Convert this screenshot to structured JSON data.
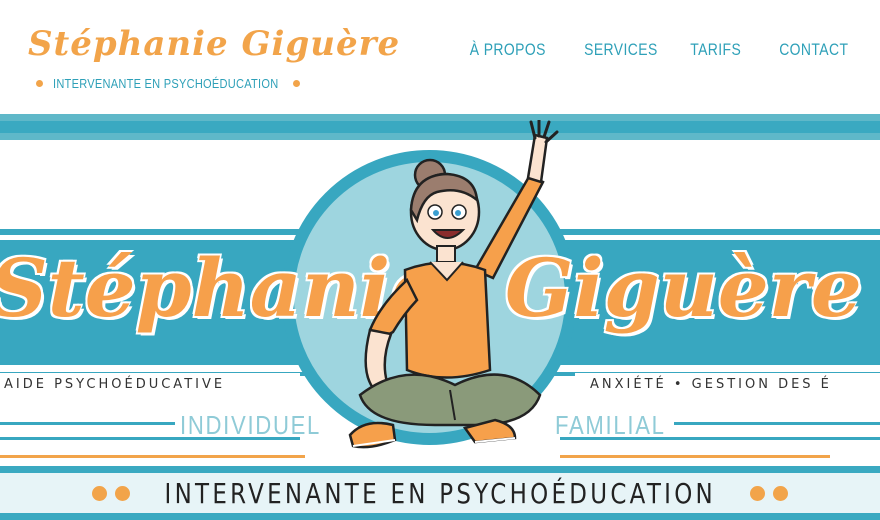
{
  "logo": {
    "name": "Stéphanie Giguère",
    "tagline": "INTERVENANTE EN PSYCHOÉDUCATION"
  },
  "nav": {
    "items": [
      "À PROPOS",
      "SERVICES",
      "TARIFS",
      "CONTACT"
    ]
  },
  "banner": {
    "first_name": "Stéphanie",
    "last_name": "Giguère",
    "strip_left": "AIDE PSYCHOÉDUCATIVE",
    "strip_right": "ANXIÉTÉ • GESTION DES É",
    "label_left": "INDIVIDUEL",
    "label_right": "FAMILIAL",
    "bottom_tagline": "INTERVENANTE EN PSYCHOÉDUCATION"
  },
  "colors": {
    "orange": "#f2a44a",
    "teal": "#38a7c0",
    "light_teal": "#9ed5df"
  }
}
